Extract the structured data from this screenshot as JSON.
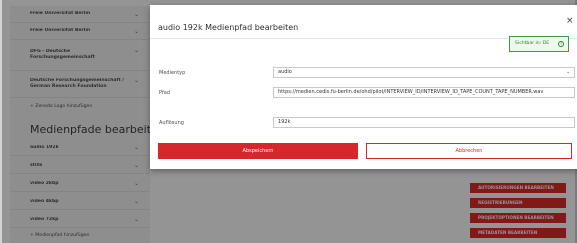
{
  "sidebar": {
    "items": [
      {
        "label": "Freie Universität Berlin"
      },
      {
        "label": "Freie Universität Berlin"
      },
      {
        "label": "DFG - Deutsche Forschungsgemeinschaft"
      },
      {
        "label": "Deutsche Forschungsgemeinschaft / German Research Foundation"
      }
    ],
    "add_link": "+ Zenodo Logo hinzufügen",
    "media_heading": "Medienpfade bearbeiten",
    "media_items": [
      {
        "label": "audio 192k"
      },
      {
        "label": "stills"
      },
      {
        "label": "video 2kbp"
      },
      {
        "label": "video 4kbp"
      },
      {
        "label": "video 72kp"
      }
    ],
    "media_add_link": "+ Medienpfad hinzufügen"
  },
  "background_buttons": [
    {
      "label": "AUTORISIERUNGEN BEARBEITEN"
    },
    {
      "label": "REGISTRIERUNGEN"
    },
    {
      "label": "PROJEKTOPTIONEN BEARBEITEN"
    },
    {
      "label": "METADATEN BEARBEITEN"
    }
  ],
  "modal": {
    "title": "audio 192k Medienpfad bearbeiten",
    "close_symbol": "×",
    "language_button": "Sichtbar in: DE",
    "language_icon": "?",
    "fields": {
      "media_type": {
        "label": "Medientyp",
        "value": "audio"
      },
      "path": {
        "label": "Pfad",
        "value": "https://medien.cedis.fu-berlin.de/ohd/pilot/INTERVIEW_ID/INTERVIEW_ID_TAPE_COUNT_TAPE_NUMBER.wav",
        "hint": ""
      },
      "resolution": {
        "label": "Auflösung",
        "value": "192k"
      }
    },
    "save_label": "Abspeichern",
    "cancel_label": "Abbrechen"
  },
  "colors": {
    "accent_red": "#d8262a",
    "success_green": "#2e842e",
    "backdrop": "rgba(0,0,0,0.42)"
  }
}
